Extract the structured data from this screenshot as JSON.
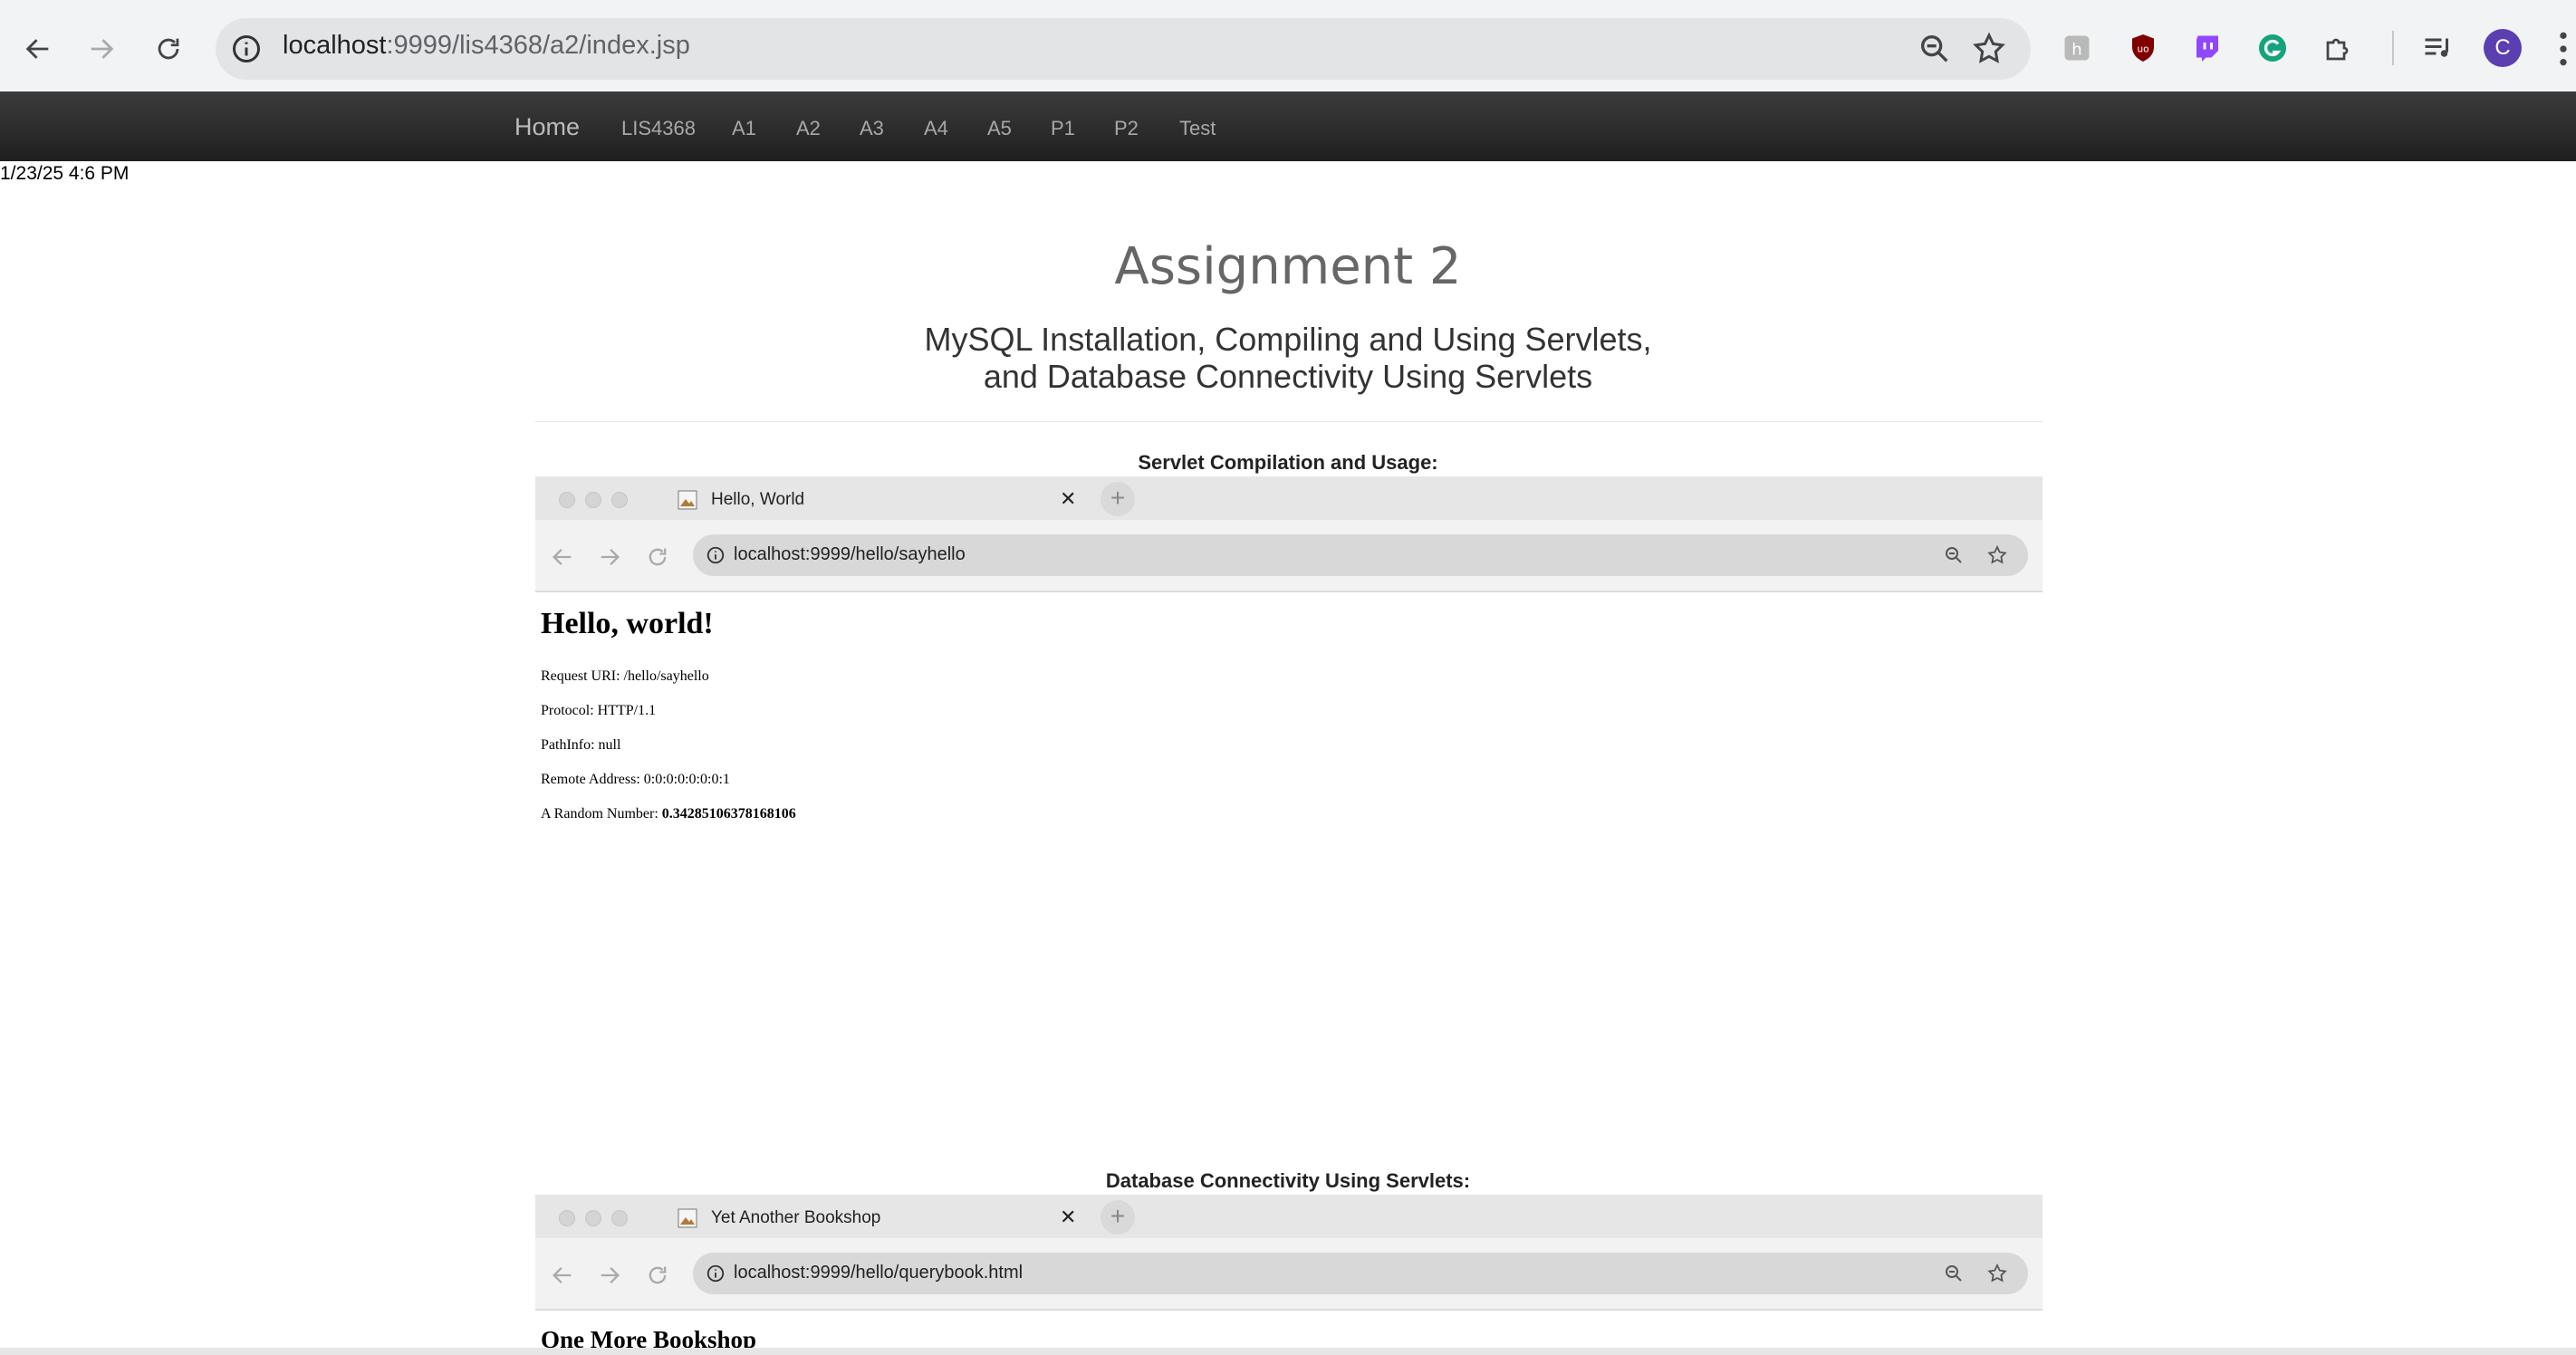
{
  "browser": {
    "url_host": "localhost",
    "url_rest": ":9999/lis4368/a2/index.jsp",
    "profile_initial": "C",
    "extensions": [
      "hacker-extension-icon",
      "ublock-icon",
      "twitch-icon",
      "grammarly-icon",
      "puzzle-extensions-icon"
    ]
  },
  "site_nav": {
    "brand": "Home",
    "items": [
      "LIS4368",
      "A1",
      "A2",
      "A3",
      "A4",
      "A5",
      "P1",
      "P2",
      "Test"
    ]
  },
  "datestamp": "1/23/25 4:6 PM",
  "page": {
    "title": "Assignment 2",
    "subtitle_line1": "MySQL Installation, Compiling and Using Servlets,",
    "subtitle_line2": "and Database Connectivity Using Servlets"
  },
  "section1": {
    "title": "Servlet Compilation and Usage:",
    "tab_title": "Hello, World",
    "url": "localhost:9999/hello/sayhello",
    "heading": "Hello, world!",
    "lines": [
      {
        "label": "Request URI: ",
        "value": "/hello/sayhello"
      },
      {
        "label": "Protocol: ",
        "value": "HTTP/1.1"
      },
      {
        "label": "PathInfo: ",
        "value": "null"
      },
      {
        "label": "Remote Address: ",
        "value": "0:0:0:0:0:0:0:1"
      }
    ],
    "random_label": "A Random Number: ",
    "random_value": "0.34285106378168106"
  },
  "section2": {
    "title": "Database Connectivity Using Servlets:",
    "tab_title": "Yet Another Bookshop",
    "url": "localhost:9999/hello/querybook.html",
    "heading": "One More Bookshop"
  },
  "colors": {
    "navbar": "#2a2a2a",
    "profile": "#5b3fb0",
    "title_gray": "#666666"
  }
}
